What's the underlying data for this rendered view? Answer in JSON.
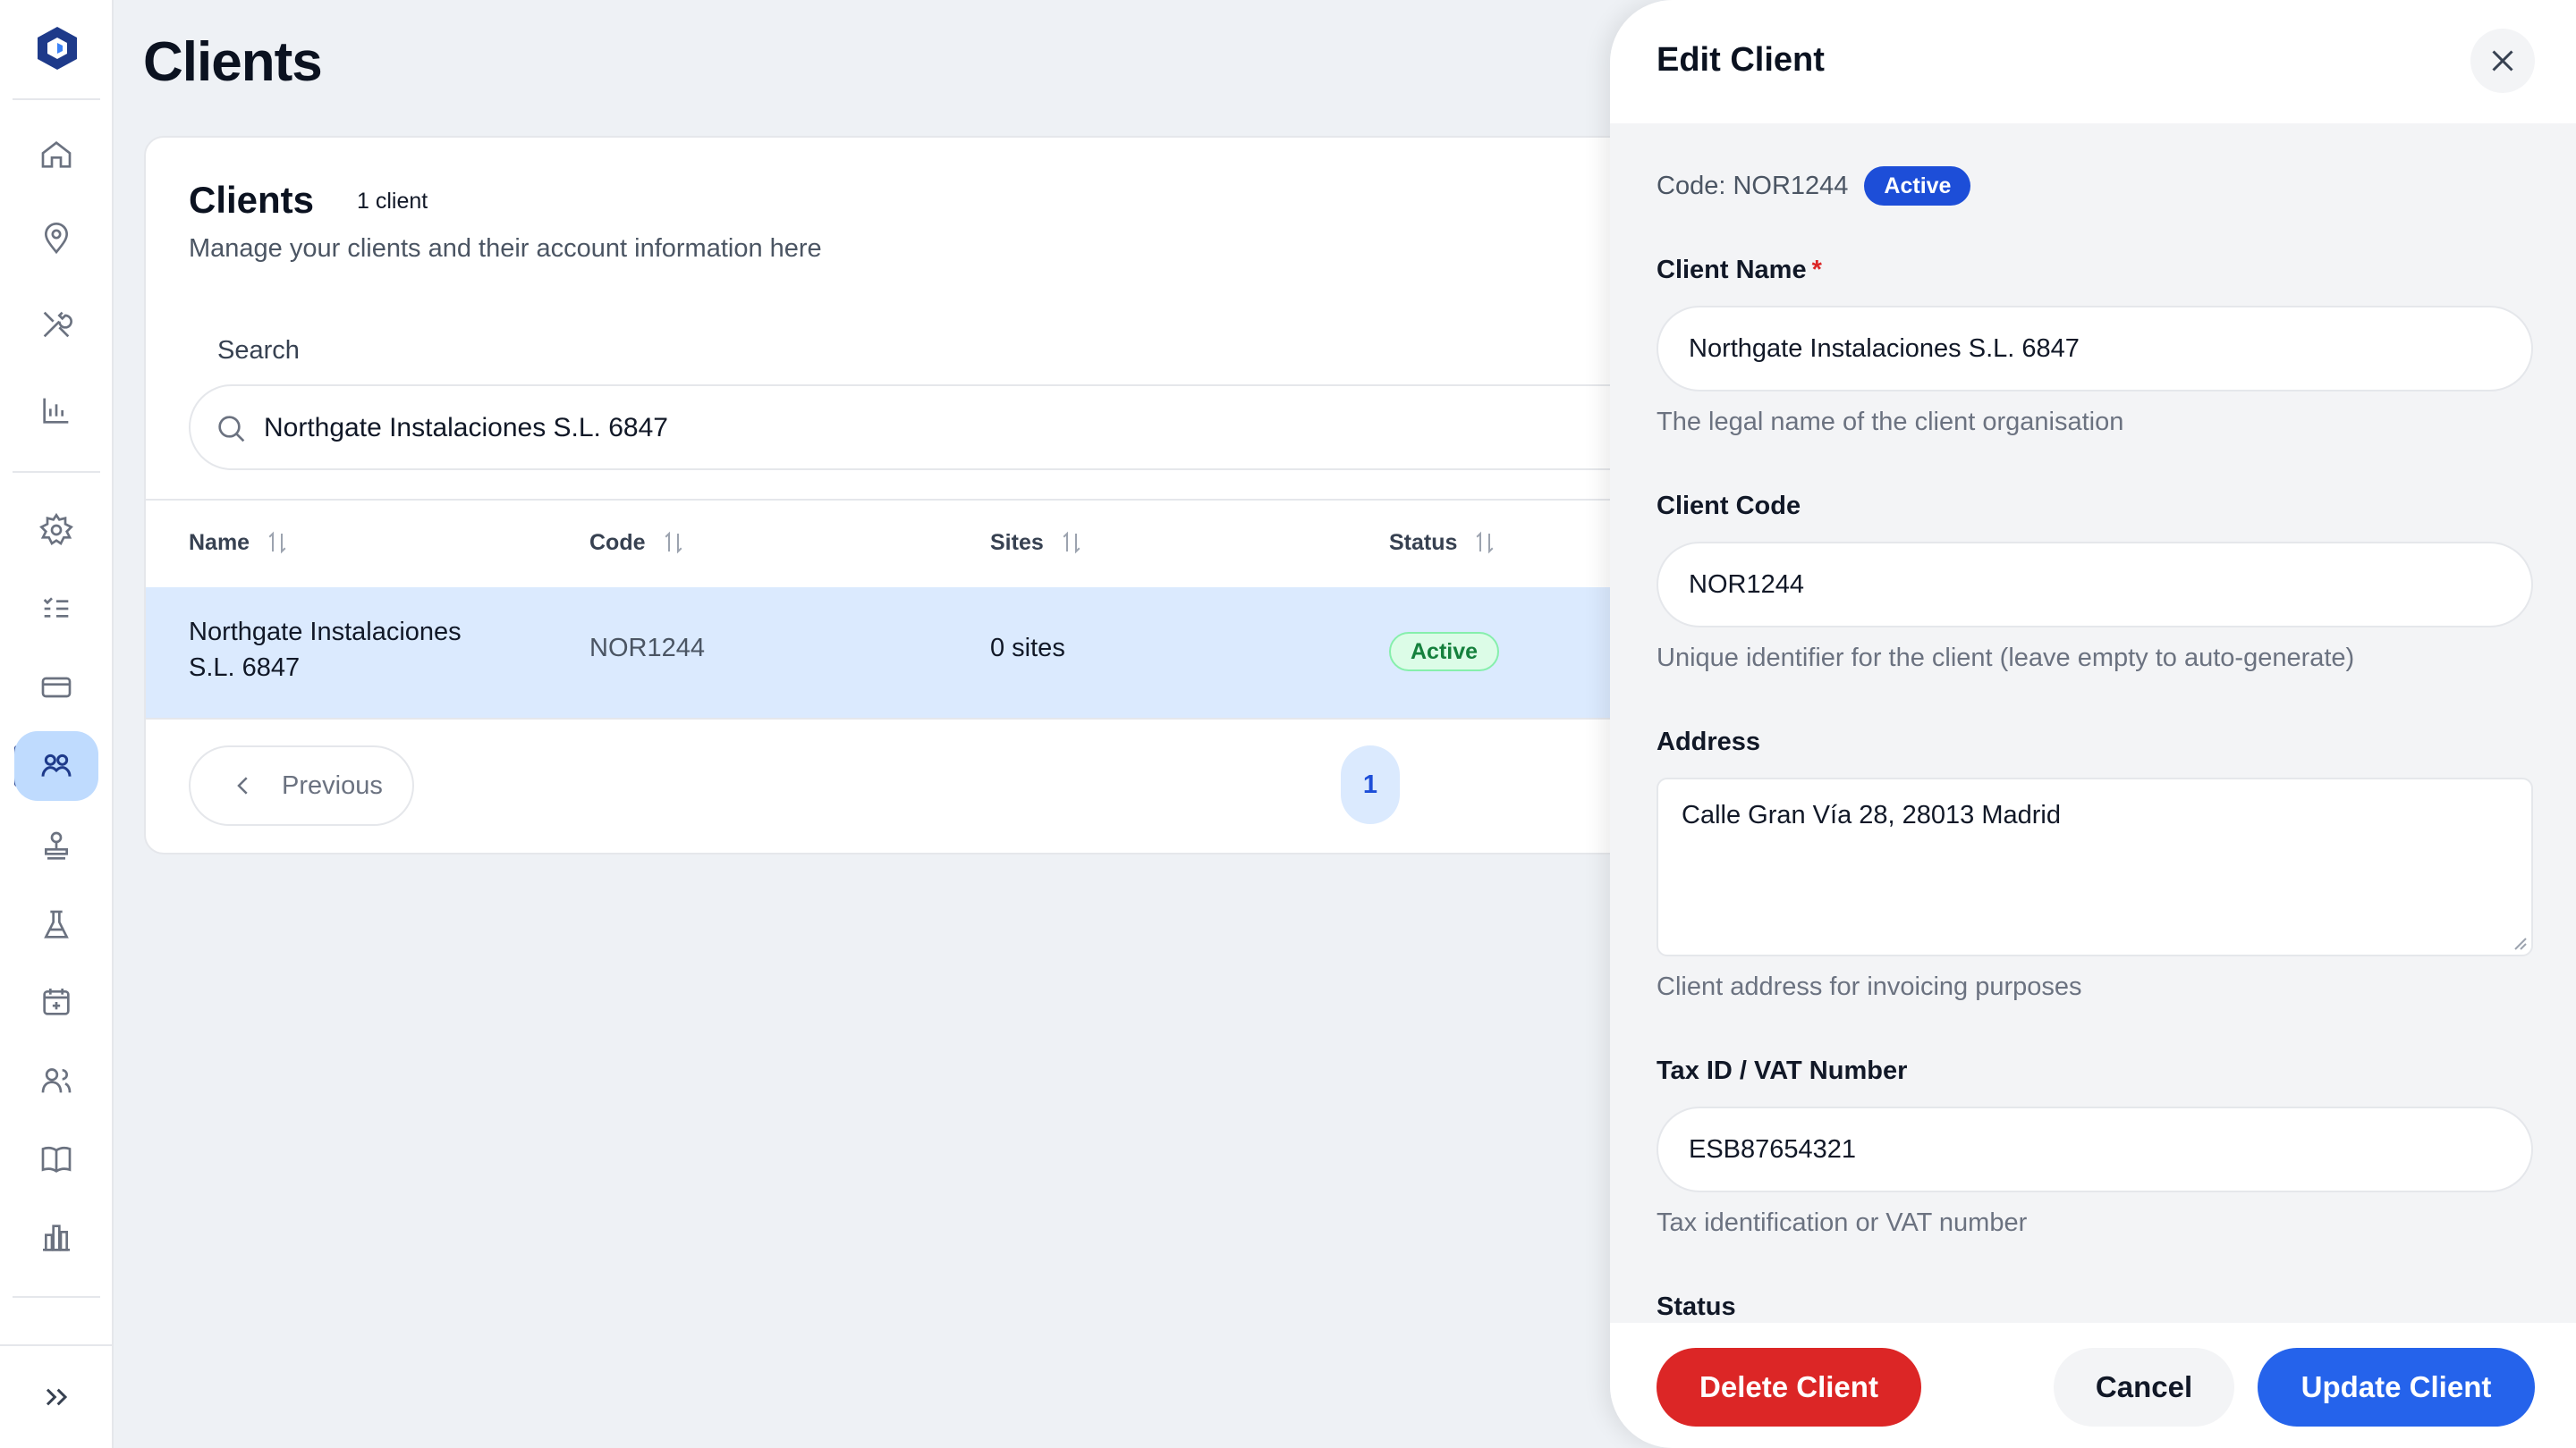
{
  "page": {
    "title": "Clients"
  },
  "sidebar": {
    "items": [
      {
        "icon": "home-icon"
      },
      {
        "icon": "map-pin-icon"
      },
      {
        "icon": "tools-icon"
      },
      {
        "icon": "bar-chart-icon"
      },
      {
        "icon": "gear-icon"
      },
      {
        "icon": "checklist-icon"
      },
      {
        "icon": "credit-card-icon"
      },
      {
        "icon": "clients-icon",
        "active": true
      },
      {
        "icon": "stamp-icon"
      },
      {
        "icon": "flask-icon"
      },
      {
        "icon": "calendar-plus-icon"
      },
      {
        "icon": "users-icon"
      },
      {
        "icon": "book-icon"
      },
      {
        "icon": "building-chart-icon"
      }
    ],
    "expand_icon": "chevrons-right-icon"
  },
  "card": {
    "title": "Clients",
    "count": "1 client",
    "subtitle": "Manage your clients and their account information here",
    "search_label": "Search",
    "search_value": "Northgate Instalaciones S.L. 6847"
  },
  "table": {
    "columns": [
      "Name",
      "Code",
      "Sites",
      "Status"
    ],
    "rows": [
      {
        "name": "Northgate Instalaciones S.L. 6847",
        "code": "NOR1244",
        "sites": "0 sites",
        "status": "Active"
      }
    ]
  },
  "pagination": {
    "previous": "Previous",
    "current_page": "1"
  },
  "drawer": {
    "title": "Edit Client",
    "code_line": "Code: NOR1244",
    "status_badge": "Active",
    "client_name": {
      "label": "Client Name",
      "required": "*",
      "value": "Northgate Instalaciones S.L. 6847",
      "help": "The legal name of the client organisation"
    },
    "client_code": {
      "label": "Client Code",
      "value": "NOR1244",
      "help": "Unique identifier for the client (leave empty to auto-generate)"
    },
    "address": {
      "label": "Address",
      "value": "Calle Gran Vía 28, 28013 Madrid",
      "help": "Client address for invoicing purposes"
    },
    "tax_id": {
      "label": "Tax ID / VAT Number",
      "value": "ESB87654321",
      "help": "Tax identification or VAT number"
    },
    "status_label": "Status",
    "buttons": {
      "delete": "Delete Client",
      "cancel": "Cancel",
      "update": "Update Client"
    }
  },
  "colors": {
    "accent": "#2563eb",
    "danger": "#dc2626",
    "success": "#15803d",
    "row_selected": "#dbeafe"
  }
}
